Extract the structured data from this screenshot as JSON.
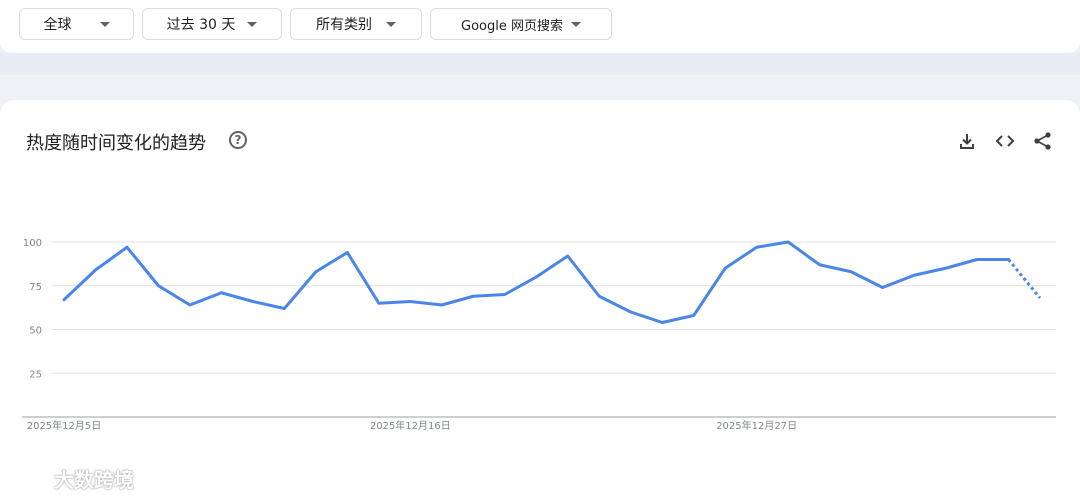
{
  "filters": [
    {
      "label": "全球"
    },
    {
      "label": "过去 30 天"
    },
    {
      "label": "所有类别"
    },
    {
      "label": "Google 网页搜索"
    }
  ],
  "chart_section": {
    "title": "热度随时间变化的趋势",
    "help_icon": "question-circle-icon",
    "tools": [
      {
        "icon": "download-icon"
      },
      {
        "icon": "embed-code-icon"
      },
      {
        "icon": "share-icon"
      }
    ]
  },
  "watermark": {
    "text": "大数跨境"
  },
  "chart_data": {
    "type": "line",
    "title": "热度随时间变化的趋势",
    "xlabel": "",
    "ylabel": "",
    "ylim": [
      0,
      100
    ],
    "y_ticks": [
      "100",
      "75",
      "50",
      "25"
    ],
    "x_tick_labels": [
      "2025年12月5日",
      "2025年12月16日",
      "2025年12月27日"
    ],
    "x": [
      "2025-12-05",
      "2025-12-06",
      "2025-12-07",
      "2025-12-08",
      "2025-12-09",
      "2025-12-10",
      "2025-12-11",
      "2025-12-12",
      "2025-12-13",
      "2025-12-14",
      "2025-12-15",
      "2025-12-16",
      "2025-12-17",
      "2025-12-18",
      "2025-12-19",
      "2025-12-20",
      "2025-12-21",
      "2025-12-22",
      "2025-12-23",
      "2025-12-24",
      "2025-12-25",
      "2025-12-26",
      "2025-12-27",
      "2025-12-28",
      "2025-12-29",
      "2025-12-30",
      "2025-12-31",
      "2026-01-01",
      "2026-01-02",
      "2026-01-03",
      "2026-01-04",
      "2026-01-05"
    ],
    "series": [
      {
        "color": "#4a86e8",
        "values": [
          67,
          84,
          97,
          75,
          64,
          71,
          66,
          62,
          83,
          94,
          65,
          66,
          64,
          69,
          70,
          80,
          92,
          69,
          60,
          54,
          58,
          85,
          97,
          100,
          87,
          83,
          74,
          81,
          85,
          90,
          90,
          68
        ],
        "partial_from_index": 30
      }
    ],
    "grid": true,
    "legend": "none"
  }
}
